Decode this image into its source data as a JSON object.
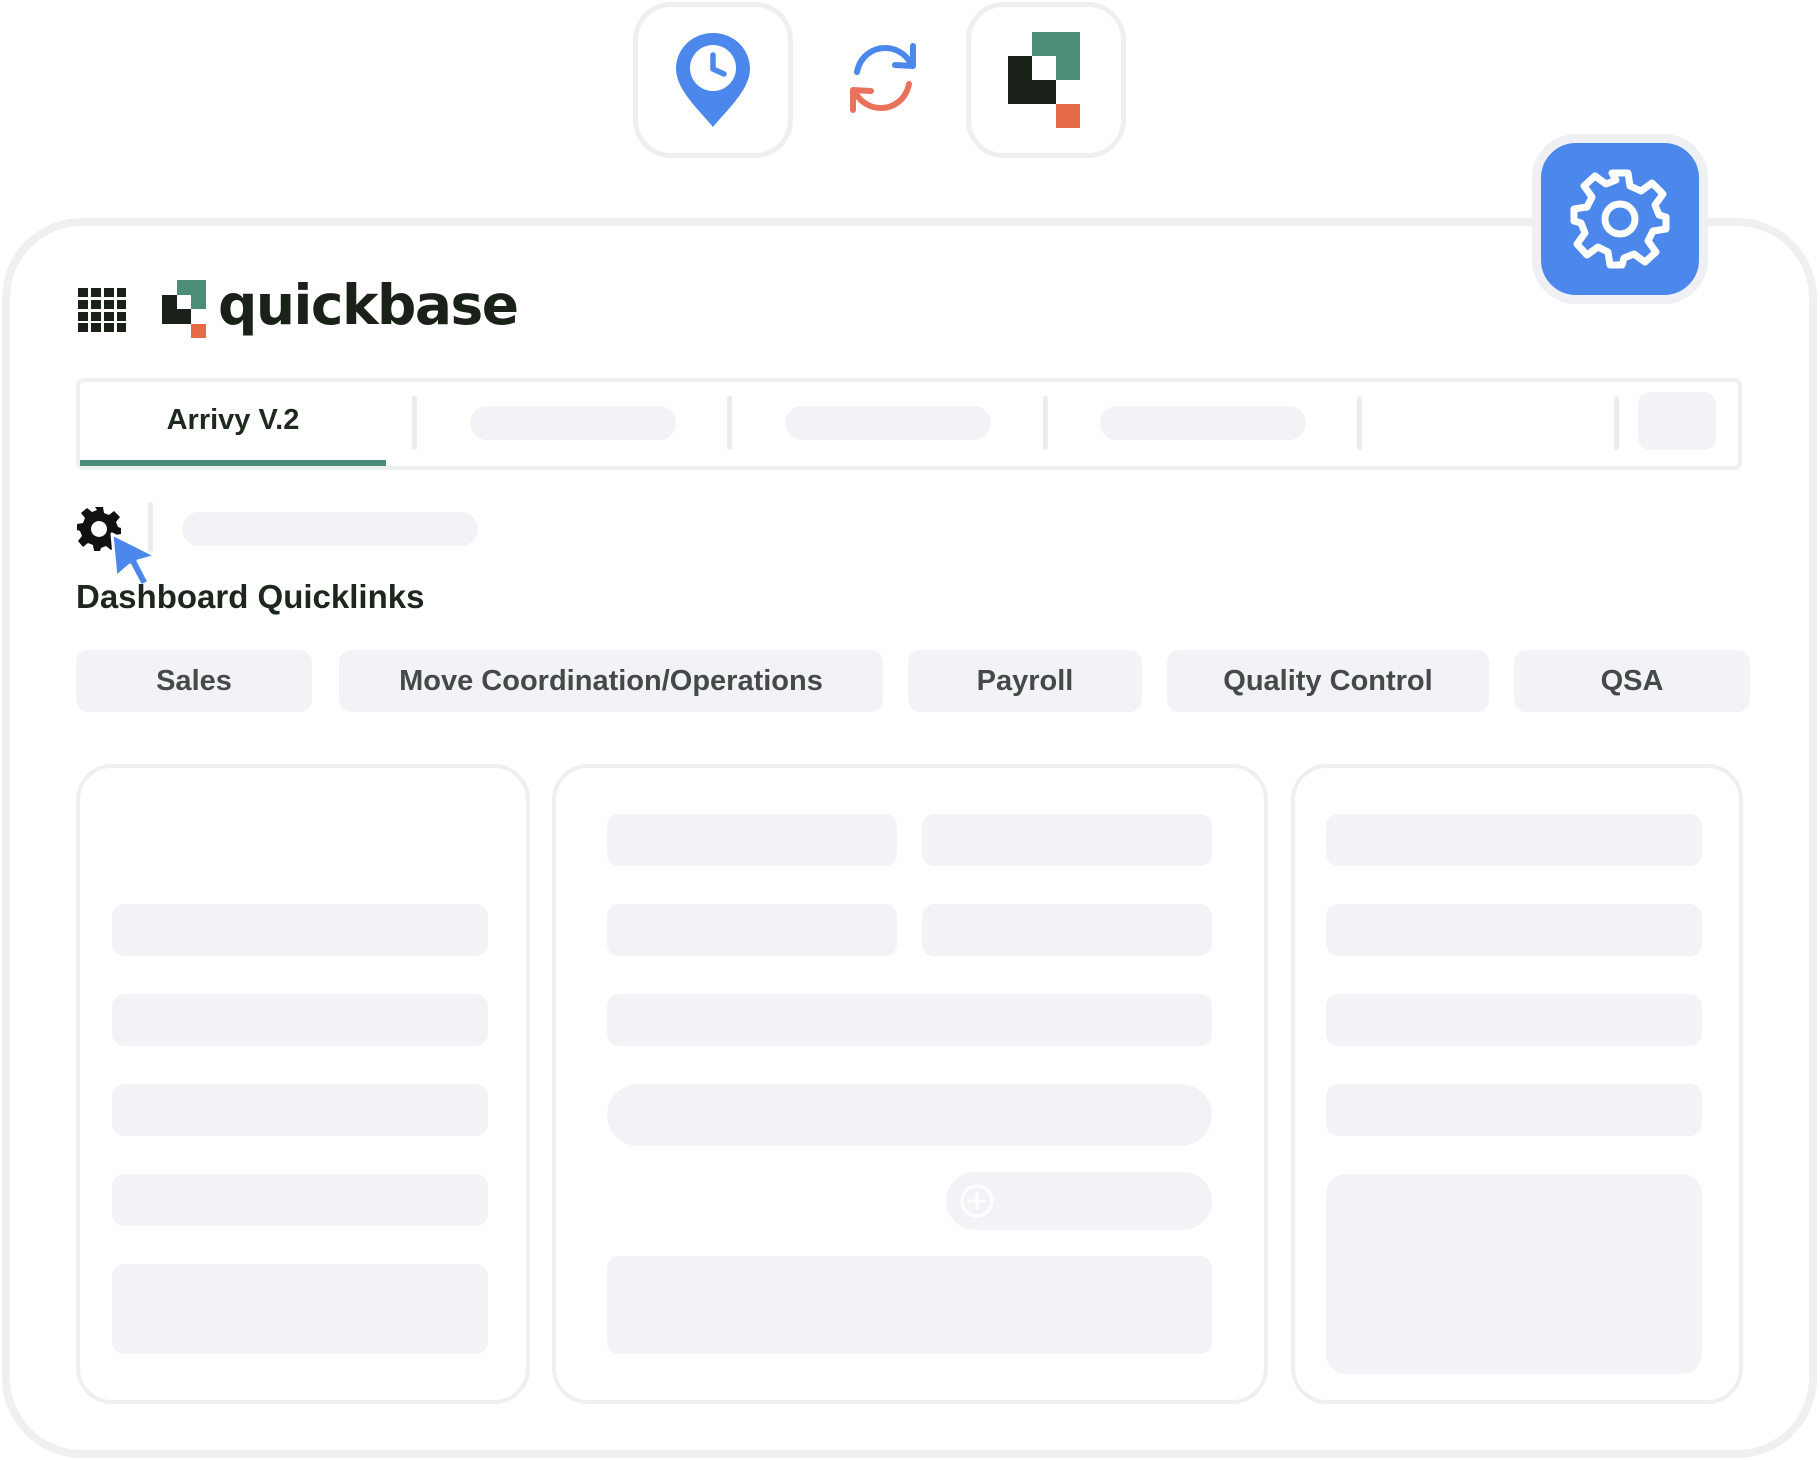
{
  "integration": {
    "left_app_icon": "location-clock-pin-icon",
    "sync_icon": "sync-arrows-icon",
    "right_app_icon": "quickbase-logo-icon",
    "settings_icon": "gear-icon"
  },
  "header": {
    "menu_icon": "app-grid-icon",
    "brand_name": "quickbase"
  },
  "tabs": [
    {
      "label": "Arrivy V.2",
      "active": true
    }
  ],
  "toolbar": {
    "settings_icon": "gear-icon",
    "cursor_icon": "pointer-cursor-icon"
  },
  "dashboard": {
    "title": "Dashboard Quicklinks",
    "quicklinks": [
      "Sales",
      "Move Coordination/Operations",
      "Payroll",
      "Quality Control",
      "QSA"
    ]
  },
  "colors": {
    "accent_blue": "#4c88ec",
    "sync_orange": "#e9735a",
    "brand_teal": "#4c8d7a",
    "brand_dark": "#1a2118",
    "brand_orange": "#e56b46",
    "placeholder": "#f3f3f7"
  }
}
